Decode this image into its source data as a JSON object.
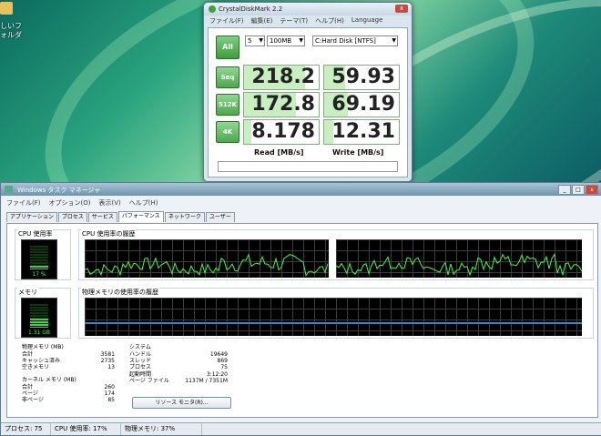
{
  "desktop": {
    "icon_label": "しいフォルダ"
  },
  "cdm": {
    "title": "CrystalDiskMark 2.2",
    "close": "x",
    "menu": [
      "ファイル(F)",
      "編集(E)",
      "テーマ(T)",
      "ヘルプ(H)",
      "Language"
    ],
    "all_label": "All",
    "runs": "5",
    "size": "100MB",
    "drive": "C:Hard Disk [NTFS]",
    "tests": [
      {
        "label": "Seq",
        "read": "218.2",
        "write": "59.93",
        "read_level": 0.82,
        "write_level": 0.28
      },
      {
        "label": "512K",
        "read": "172.8",
        "write": "69.19",
        "read_level": 0.7,
        "write_level": 0.32
      },
      {
        "label": "4K",
        "read": "8.178",
        "write": "12.31",
        "read_level": 0.1,
        "write_level": 0.12
      }
    ],
    "read_header": "Read [MB/s]",
    "write_header": "Write [MB/s]"
  },
  "tm": {
    "title": "Windows タスク マネージャ",
    "menu": [
      "ファイル(F)",
      "オプション(O)",
      "表示(V)",
      "ヘルプ(H)"
    ],
    "tabs": [
      "アプリケーション",
      "プロセス",
      "サービス",
      "パフォーマンス",
      "ネットワーク",
      "ユーザー"
    ],
    "active_tab": "パフォーマンス",
    "cpu_usage_label": "CPU 使用率",
    "cpu_history_label": "CPU 使用率の履歴",
    "cpu_value": "17 %",
    "cpu_level": 0.17,
    "mem_label": "メモリ",
    "mem_history_label": "物理メモリの使用率の履歴",
    "mem_value": "1.31 GB",
    "mem_level": 0.37,
    "physical": {
      "title": "物理メモリ (MB)",
      "rows": [
        [
          "合計",
          "3581"
        ],
        [
          "キャッシュ済み",
          "2735"
        ],
        [
          "空きメモリ",
          "13"
        ]
      ]
    },
    "kernel": {
      "title": "カーネル メモリ (MB)",
      "rows": [
        [
          "合計",
          "260"
        ],
        [
          "ページ",
          "174"
        ],
        [
          "非ページ",
          "85"
        ]
      ]
    },
    "system": {
      "title": "システム",
      "rows": [
        [
          "ハンドル",
          "19649"
        ],
        [
          "スレッド",
          "869"
        ],
        [
          "プロセス",
          "75"
        ],
        [
          "起動時間",
          "3:12:20"
        ],
        [
          "ページ ファイル",
          "1137M / 7351M"
        ]
      ]
    },
    "resmon_button": "リソース モニタ(R)...",
    "status": {
      "processes": "プロセス: 75",
      "cpu": "CPU 使用率: 17%",
      "memory": "物理メモリ: 37%"
    }
  }
}
